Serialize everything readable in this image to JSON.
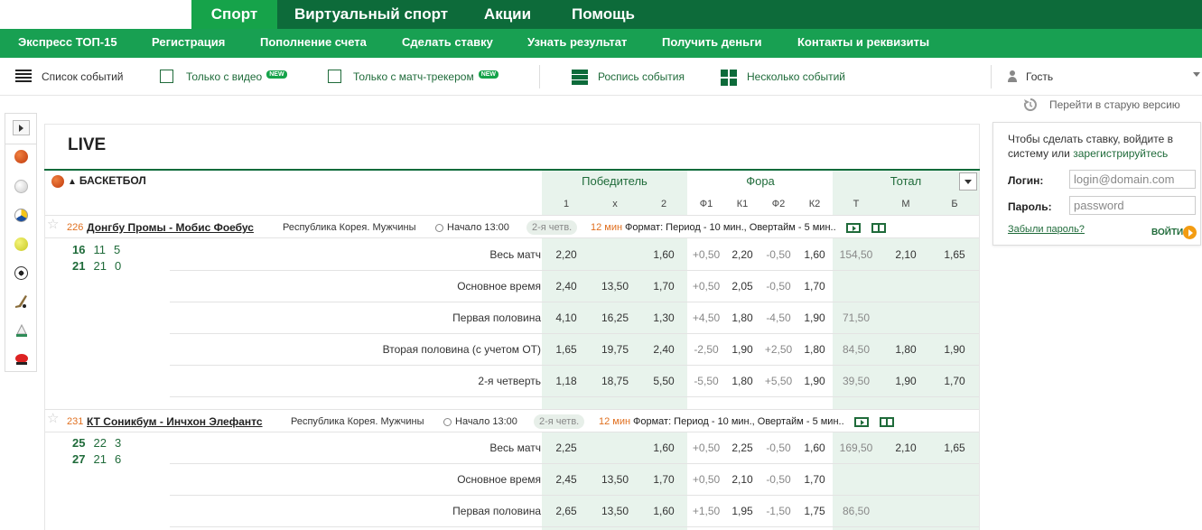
{
  "top_tabs": [
    "Спорт",
    "Виртуальный спорт",
    "Акции",
    "Помощь"
  ],
  "menu": [
    "Экспресс ТОП-15",
    "Регистрация",
    "Пополнение счета",
    "Сделать ставку",
    "Узнать результат",
    "Получить деньги",
    "Контакты и реквизиты"
  ],
  "toolbar": {
    "events_list": "Список событий",
    "only_video": "Только с видео",
    "only_tracker": "Только с матч-трекером",
    "new_badge": "NEW",
    "schedule": "Роспись события",
    "multi": "Несколько событий",
    "user": "Гость"
  },
  "old_version": "Перейти в старую версию",
  "live": {
    "title": "LIVE",
    "sport": "БАСКЕТБОЛ",
    "groups": [
      "Победитель",
      "Фора",
      "Тотал"
    ],
    "subs": [
      "1",
      "x",
      "2",
      "Ф1",
      "К1",
      "Ф2",
      "К2",
      "Т",
      "М",
      "Б"
    ]
  },
  "events": [
    {
      "num": "226",
      "name": "Донгбу Промы - Мобис Фоебус",
      "league": "Республика Корея. Мужчины",
      "start": "Начало 13:00",
      "period": "2-я четв.",
      "minutes": "12 мин",
      "format": "Формат: Период - 10 мин., Овертайм - 5 мин..",
      "score1": [
        "16",
        "11",
        "5"
      ],
      "score2": [
        "21",
        "21",
        "0"
      ],
      "markets": [
        {
          "name": "Весь матч",
          "odds": [
            "2,20",
            "",
            "1,60",
            "+0,50",
            "2,20",
            "-0,50",
            "1,60",
            "154,50",
            "2,10",
            "1,65"
          ]
        },
        {
          "name": "Основное время",
          "odds": [
            "2,40",
            "13,50",
            "1,70",
            "+0,50",
            "2,05",
            "-0,50",
            "1,70",
            "",
            "",
            ""
          ]
        },
        {
          "name": "Первая половина",
          "odds": [
            "4,10",
            "16,25",
            "1,30",
            "+4,50",
            "1,80",
            "-4,50",
            "1,90",
            "71,50",
            "",
            ""
          ]
        },
        {
          "name": "Вторая половина (с учетом ОТ)",
          "odds": [
            "1,65",
            "19,75",
            "2,40",
            "-2,50",
            "1,90",
            "+2,50",
            "1,80",
            "84,50",
            "1,80",
            "1,90"
          ]
        },
        {
          "name": "2-я четверть",
          "odds": [
            "1,18",
            "18,75",
            "5,50",
            "-5,50",
            "1,80",
            "+5,50",
            "1,90",
            "39,50",
            "1,90",
            "1,70"
          ]
        }
      ]
    },
    {
      "num": "231",
      "name": "КТ Соникбум - Инчхон Элефантс",
      "league": "Республика Корея. Мужчины",
      "start": "Начало 13:00",
      "period": "2-я четв.",
      "minutes": "12 мин",
      "format": "Формат: Период - 10 мин., Овертайм - 5 мин..",
      "score1": [
        "25",
        "22",
        "3"
      ],
      "score2": [
        "27",
        "21",
        "6"
      ],
      "markets": [
        {
          "name": "Весь матч",
          "odds": [
            "2,25",
            "",
            "1,60",
            "+0,50",
            "2,25",
            "-0,50",
            "1,60",
            "169,50",
            "2,10",
            "1,65"
          ]
        },
        {
          "name": "Основное время",
          "odds": [
            "2,45",
            "13,50",
            "1,70",
            "+0,50",
            "2,10",
            "-0,50",
            "1,70",
            "",
            "",
            ""
          ]
        },
        {
          "name": "Первая половина",
          "odds": [
            "2,65",
            "13,50",
            "1,60",
            "+1,50",
            "1,95",
            "-1,50",
            "1,75",
            "86,50",
            "",
            ""
          ]
        }
      ]
    }
  ],
  "login": {
    "hint": "Чтобы сделать ставку, войдите в систему или",
    "register_link": "зарегистрируйтесь",
    "login_label": "Логин:",
    "login_placeholder": "login@domain.com",
    "password_label": "Пароль:",
    "password_placeholder": "password",
    "forgot": "Забыли пароль?",
    "enter": "ВОЙТИ"
  },
  "colors": {
    "dark_green": "#0d6b3a",
    "green": "#18a052",
    "accent_orange": "#e07020",
    "column_bg": "#e8f3ec"
  }
}
